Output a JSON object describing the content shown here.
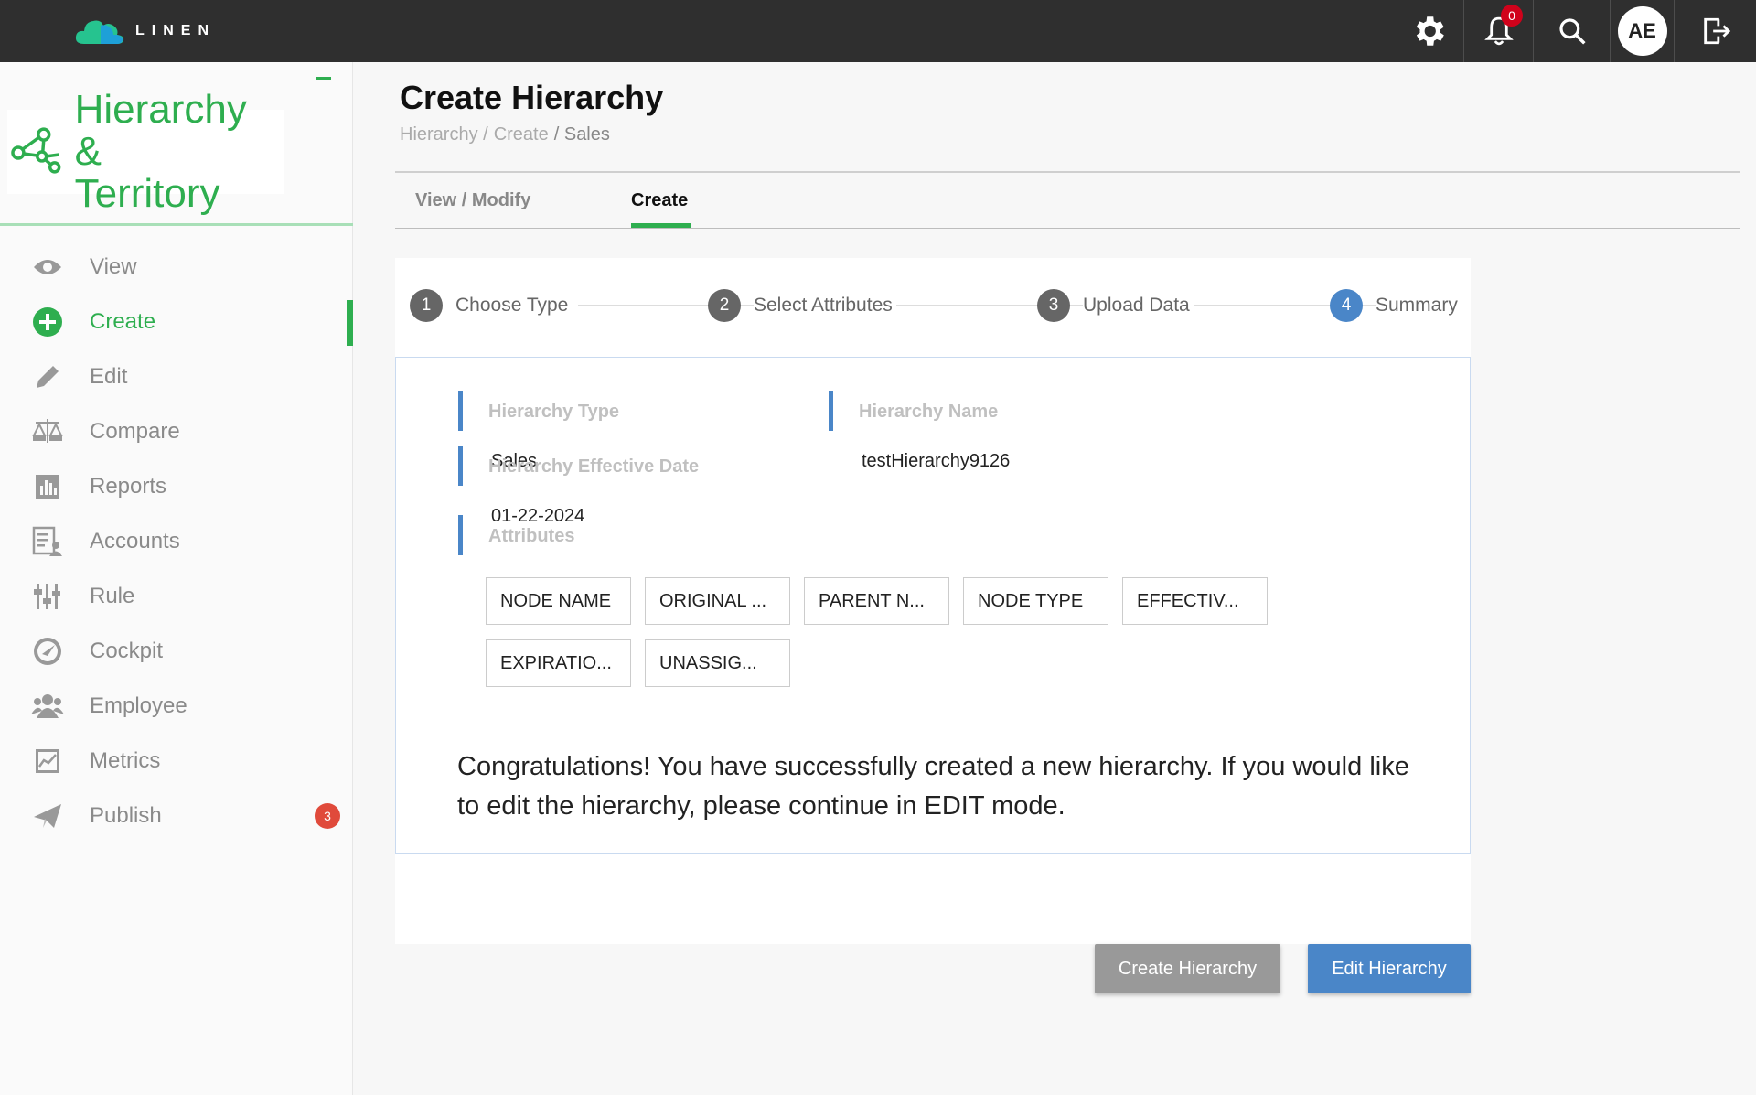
{
  "brand": {
    "name": "LINEN"
  },
  "topbar": {
    "notification_count": "0",
    "avatar_initials": "AE",
    "icons": [
      "gear-icon",
      "bell-icon",
      "search-icon",
      "logout-icon"
    ]
  },
  "sidebar": {
    "module_title_line1": "Hierarchy &",
    "module_title_line2": "Territory",
    "items": [
      {
        "label": "View",
        "icon": "eye-icon"
      },
      {
        "label": "Create",
        "icon": "plus-circle-icon",
        "active": true
      },
      {
        "label": "Edit",
        "icon": "pencil-icon"
      },
      {
        "label": "Compare",
        "icon": "scales-icon"
      },
      {
        "label": "Reports",
        "icon": "bar-chart-icon"
      },
      {
        "label": "Accounts",
        "icon": "accounts-icon"
      },
      {
        "label": "Rule",
        "icon": "sliders-icon"
      },
      {
        "label": "Cockpit",
        "icon": "gauge-icon"
      },
      {
        "label": "Employee",
        "icon": "people-icon"
      },
      {
        "label": "Metrics",
        "icon": "line-chart-icon"
      },
      {
        "label": "Publish",
        "icon": "paper-plane-icon",
        "badge": "3"
      }
    ]
  },
  "page": {
    "title": "Create Hierarchy",
    "breadcrumb": [
      "Hierarchy /",
      "Create",
      "/ Sales"
    ]
  },
  "tabs": [
    {
      "label": "View / Modify"
    },
    {
      "label": "Create",
      "active": true
    }
  ],
  "stepper": [
    {
      "num": "1",
      "label": "Choose Type"
    },
    {
      "num": "2",
      "label": "Select Attributes"
    },
    {
      "num": "3",
      "label": "Upload Data"
    },
    {
      "num": "4",
      "label": "Summary",
      "current": true
    }
  ],
  "summary": {
    "hierarchy_type_label": "Hierarchy Type",
    "hierarchy_type_value": "Sales",
    "hierarchy_name_label": "Hierarchy Name",
    "hierarchy_name_value": "testHierarchy9126",
    "effective_date_label": "Hierarchy Effective Date",
    "effective_date_value": "01-22-2024",
    "attributes_label": "Attributes",
    "attributes": [
      "NODE NAME",
      "ORIGINAL ...",
      "PARENT N...",
      "NODE TYPE",
      "EFFECTIV...",
      "EXPIRATIO...",
      "UNASSIG..."
    ],
    "message": "Congratulations! You have successfully created a new hierarchy. If you would like to edit the hierarchy, please continue in EDIT mode."
  },
  "actions": {
    "create_label": "Create Hierarchy",
    "edit_label": "Edit Hierarchy"
  },
  "colors": {
    "accent_green": "#2eae4f",
    "accent_blue": "#4a86c8",
    "topbar": "#2f2f2f",
    "badge_red": "#d0021b"
  }
}
